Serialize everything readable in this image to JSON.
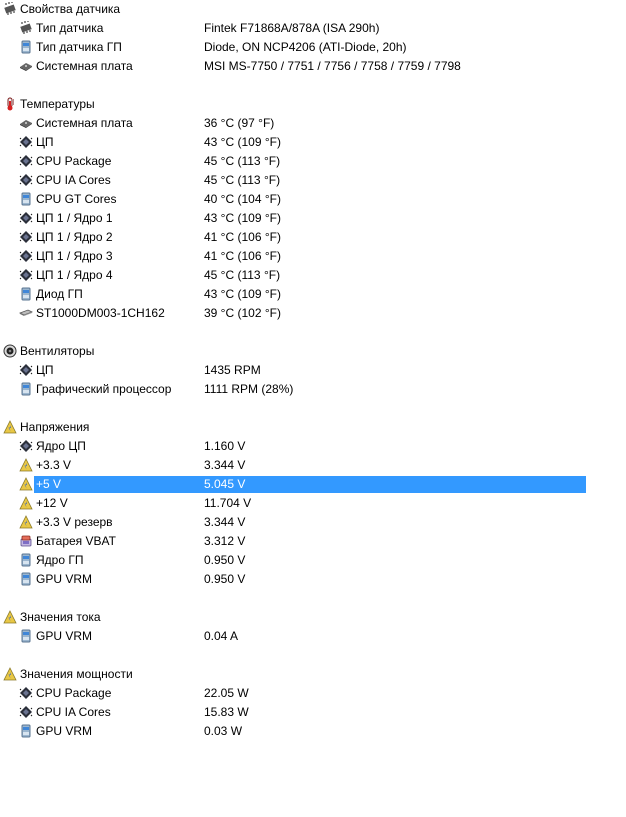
{
  "sections": [
    {
      "title": "Свойства датчика",
      "icon": "chip-icon",
      "items": [
        {
          "label": "Тип датчика",
          "value": "Fintek F71868A/878A  (ISA 290h)",
          "icon": "chip-icon"
        },
        {
          "label": "Тип датчика ГП",
          "value": "Diode, ON NCP4206  (ATI-Diode, 20h)",
          "icon": "gpu-icon"
        },
        {
          "label": "Системная плата",
          "value": "MSI MS-7750 / 7751 / 7756 / 7758 / 7759 / 7798",
          "icon": "motherboard-icon"
        }
      ]
    },
    {
      "title": "Температуры",
      "icon": "thermometer-icon",
      "items": [
        {
          "label": "Системная плата",
          "value": "36 °C  (97 °F)",
          "icon": "motherboard-icon"
        },
        {
          "label": "ЦП",
          "value": "43 °C  (109 °F)",
          "icon": "cpu-icon"
        },
        {
          "label": "CPU Package",
          "value": "45 °C  (113 °F)",
          "icon": "cpu-icon"
        },
        {
          "label": "CPU IA Cores",
          "value": "45 °C  (113 °F)",
          "icon": "cpu-icon"
        },
        {
          "label": "CPU GT Cores",
          "value": "40 °C  (104 °F)",
          "icon": "gpu-icon"
        },
        {
          "label": "ЦП 1 / Ядро 1",
          "value": "43 °C  (109 °F)",
          "icon": "cpu-icon"
        },
        {
          "label": "ЦП 1 / Ядро 2",
          "value": "41 °C  (106 °F)",
          "icon": "cpu-icon"
        },
        {
          "label": "ЦП 1 / Ядро 3",
          "value": "41 °C  (106 °F)",
          "icon": "cpu-icon"
        },
        {
          "label": "ЦП 1 / Ядро 4",
          "value": "45 °C  (113 °F)",
          "icon": "cpu-icon"
        },
        {
          "label": "Диод ГП",
          "value": "43 °C  (109 °F)",
          "icon": "gpu-icon"
        },
        {
          "label": "ST1000DM003-1CH162",
          "value": "39 °C  (102 °F)",
          "icon": "hard-drive-icon"
        }
      ]
    },
    {
      "title": "Вентиляторы",
      "icon": "fan-icon",
      "items": [
        {
          "label": "ЦП",
          "value": "1435 RPM",
          "icon": "cpu-icon"
        },
        {
          "label": "Графический процессор",
          "value": "1111 RPM  (28%)",
          "icon": "gpu-icon"
        }
      ]
    },
    {
      "title": "Напряжения",
      "icon": "voltage-warning-icon",
      "items": [
        {
          "label": "Ядро ЦП",
          "value": "1.160 V",
          "icon": "cpu-icon"
        },
        {
          "label": "+3.3 V",
          "value": "3.344 V",
          "icon": "voltage-warning-icon"
        },
        {
          "label": "+5 V",
          "value": "5.045 V",
          "icon": "voltage-warning-icon",
          "selected": true
        },
        {
          "label": "+12 V",
          "value": "11.704 V",
          "icon": "voltage-warning-icon"
        },
        {
          "label": "+3.3 V резерв",
          "value": "3.344 V",
          "icon": "voltage-warning-icon"
        },
        {
          "label": "Батарея VBAT",
          "value": "3.312 V",
          "icon": "battery-icon"
        },
        {
          "label": "Ядро ГП",
          "value": "0.950 V",
          "icon": "gpu-icon"
        },
        {
          "label": "GPU VRM",
          "value": "0.950 V",
          "icon": "gpu-icon"
        }
      ]
    },
    {
      "title": "Значения тока",
      "icon": "voltage-warning-icon",
      "items": [
        {
          "label": "GPU VRM",
          "value": "0.04 A",
          "icon": "gpu-icon"
        }
      ]
    },
    {
      "title": "Значения мощности",
      "icon": "voltage-warning-icon",
      "items": [
        {
          "label": "CPU Package",
          "value": "22.05 W",
          "icon": "cpu-icon"
        },
        {
          "label": "CPU IA Cores",
          "value": "15.83 W",
          "icon": "cpu-icon"
        },
        {
          "label": "GPU VRM",
          "value": "0.03 W",
          "icon": "gpu-icon"
        }
      ]
    }
  ],
  "colors": {
    "selection": "#3399ff",
    "selection_text": "#ffffff"
  }
}
